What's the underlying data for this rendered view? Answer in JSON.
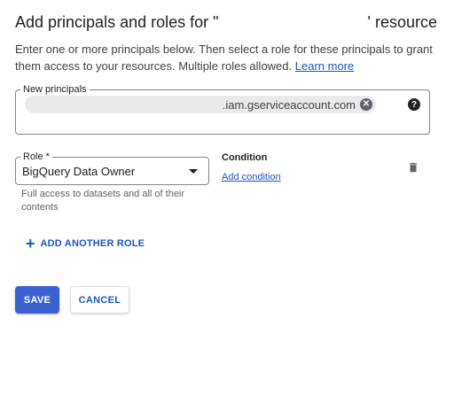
{
  "header": {
    "title_start": "Add principals and roles for \"",
    "title_end": "' resource"
  },
  "description": {
    "text": "Enter one or more principals below. Then select a role for these principals to grant them access to your resources. Multiple roles allowed. ",
    "link": "Learn more"
  },
  "principals": {
    "legend": "New principals",
    "chip_text": ".iam.gserviceaccount.com",
    "chip_remove_glyph": "✕",
    "help_glyph": "?"
  },
  "role": {
    "legend": "Role *",
    "value": "BigQuery Data Owner",
    "hint": "Full access to datasets and all of their contents"
  },
  "condition": {
    "title": "Condition",
    "link": "Add condition"
  },
  "actions": {
    "add_role_icon": "+",
    "add_role": "ADD ANOTHER ROLE",
    "save": "SAVE",
    "cancel": "CANCEL"
  },
  "colors": {
    "accent": "#1a56c4",
    "primary_button": "#3b61d1"
  }
}
